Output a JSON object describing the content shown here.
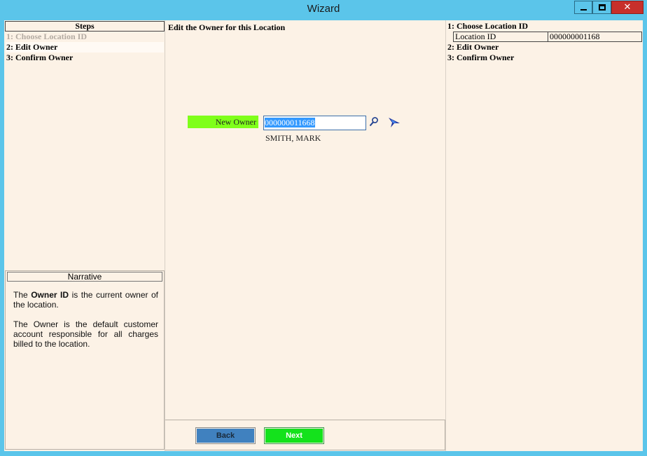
{
  "window": {
    "title": "Wizard",
    "minimize_label": "",
    "maximize_label": "",
    "close_label": "✕",
    "colors": {
      "titlebar": "#5bc5ea",
      "close": "#c7302b",
      "client_bg": "#fcf2e6"
    }
  },
  "steps_panel": {
    "header": "Steps",
    "items": [
      {
        "label": "1: Choose Location ID",
        "state": "completed"
      },
      {
        "label": "2: Edit Owner",
        "state": "current"
      },
      {
        "label": "3: Confirm Owner",
        "state": "pending"
      }
    ]
  },
  "narrative": {
    "header": "Narrative",
    "p1_prefix": "The ",
    "p1_bold": "Owner ID",
    "p1_suffix": " is the current owner of the location.",
    "p2": "The Owner is the default customer account responsible for all charges billed to the location."
  },
  "main": {
    "heading": "Edit the Owner for this Location",
    "owner_label": "New Owner",
    "owner_value": "000000011668",
    "owner_name": "SMITH, MARK",
    "icons": {
      "search": "search-icon",
      "navigate": "navigate-arrow-icon"
    },
    "colors": {
      "label_bg": "#7fff1a",
      "selection": "#3399ff"
    }
  },
  "buttons": {
    "back": "Back",
    "next": "Next",
    "colors": {
      "back": "#4081bf",
      "next": "#14e21c"
    }
  },
  "summary": {
    "step1": "1: Choose Location ID",
    "location_id_label": "Location ID",
    "location_id_value": "000000001168",
    "step2": "2: Edit Owner",
    "step3": "3: Confirm Owner"
  }
}
